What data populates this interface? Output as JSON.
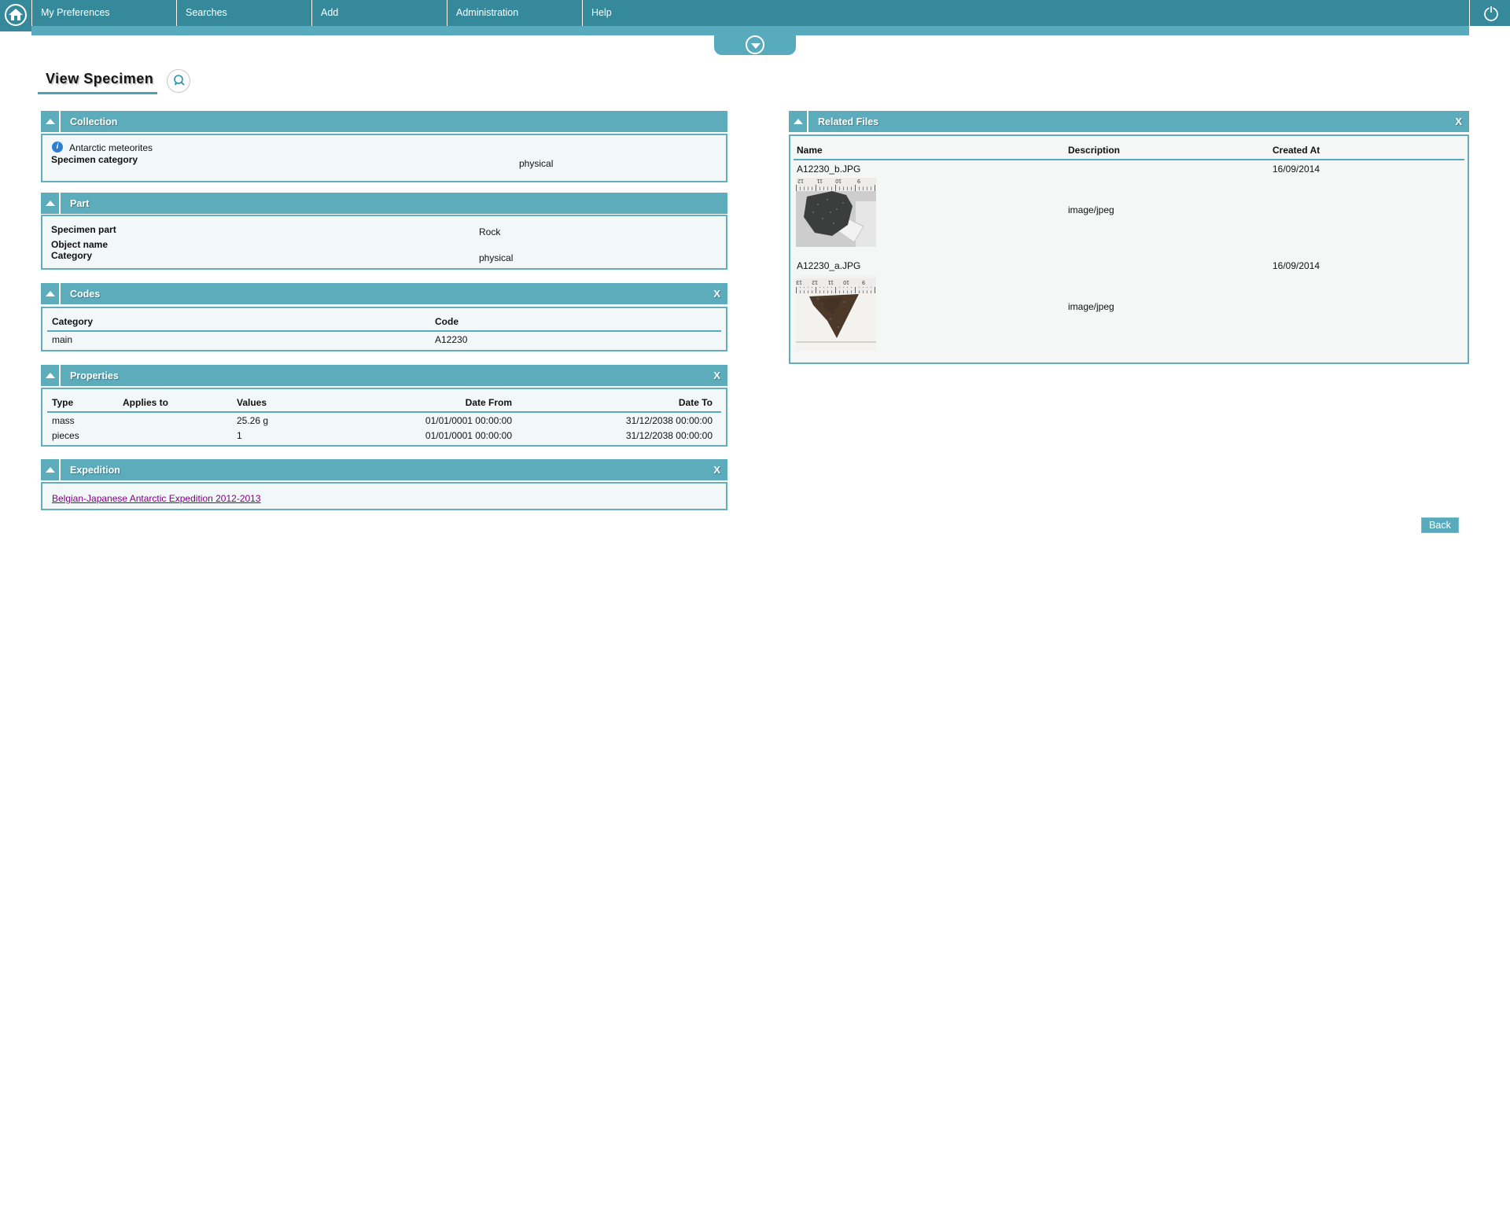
{
  "nav": {
    "items": [
      {
        "label": "My Preferences"
      },
      {
        "label": "Searches"
      },
      {
        "label": "Add"
      },
      {
        "label": "Administration"
      },
      {
        "label": "Help"
      }
    ]
  },
  "page": {
    "title": "View Specimen"
  },
  "panels": {
    "collection": {
      "title": "Collection",
      "info_icon": "i",
      "info_text": "Antarctic meteorites",
      "fields": [
        {
          "label": "Specimen category",
          "value": "physical"
        }
      ]
    },
    "part": {
      "title": "Part",
      "fields": [
        {
          "label": "Specimen part",
          "value": "Rock"
        },
        {
          "label": "Object name",
          "value": ""
        },
        {
          "label": "Category",
          "value": "physical"
        }
      ]
    },
    "codes": {
      "title": "Codes",
      "close_label": "X",
      "columns": [
        "Category",
        "Code"
      ],
      "rows": [
        [
          "main",
          "A12230"
        ]
      ]
    },
    "properties": {
      "title": "Properties",
      "close_label": "X",
      "columns": [
        "Type",
        "Applies to",
        "Values",
        "Date From",
        "Date To"
      ],
      "rows": [
        {
          "type": "mass",
          "applies_to": "",
          "values": "25.26 g",
          "date_from": "01/01/0001 00:00:00",
          "date_to": "31/12/2038 00:00:00"
        },
        {
          "type": "pieces",
          "applies_to": "",
          "values": "1",
          "date_from": "01/01/0001 00:00:00",
          "date_to": "31/12/2038 00:00:00"
        }
      ]
    },
    "expedition": {
      "title": "Expedition",
      "close_label": "X",
      "link": "Belgian-Japanese Antarctic Expedition 2012-2013"
    },
    "related_files": {
      "title": "Related Files",
      "close_label": "X",
      "columns": [
        "Name",
        "Description",
        "Created At"
      ],
      "files": [
        {
          "name": "A12230_b.JPG",
          "description": "image/jpeg",
          "created_at": "16/09/2014",
          "ruler": [
            "12",
            "11",
            "10",
            "9"
          ]
        },
        {
          "name": "A12230_a.JPG",
          "description": "image/jpeg",
          "created_at": "16/09/2014",
          "ruler": [
            "13",
            "12",
            "11",
            "10",
            "9"
          ]
        }
      ]
    }
  },
  "buttons": {
    "back": "Back"
  },
  "colors": {
    "nav_teal": "#35899b",
    "accent_teal": "#58abbc",
    "panel_border": "#64adbb",
    "panel_bg": "#f2f8f8",
    "link_purple": "#800080",
    "info_blue": "#2e7fd0",
    "muted_gray": "#c2c5c7"
  }
}
